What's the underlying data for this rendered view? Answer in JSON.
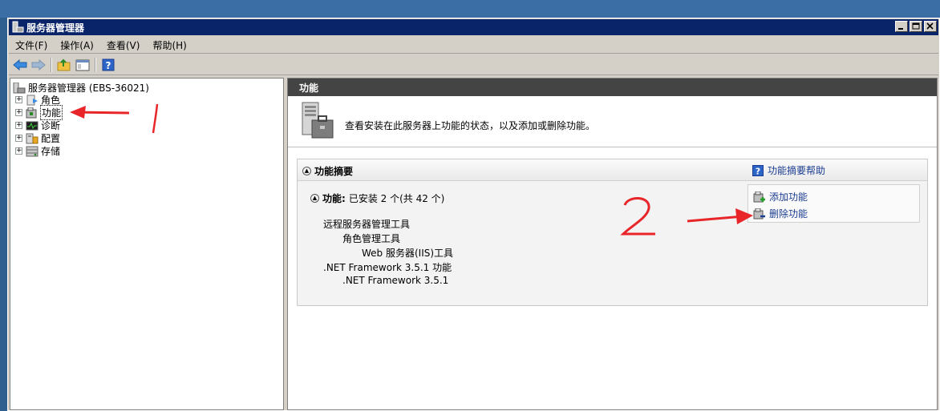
{
  "window": {
    "title": "服务器管理器"
  },
  "menu": {
    "items": [
      "文件(F)",
      "操作(A)",
      "查看(V)",
      "帮助(H)"
    ]
  },
  "toolbar": {
    "icons": [
      "back-icon",
      "forward-icon",
      "up-folder-icon",
      "show-hide-tree-icon",
      "help-icon"
    ]
  },
  "tree": {
    "root_label": "服务器管理器 (EBS-36021)",
    "items": [
      {
        "label": "角色",
        "icon": "roles-icon"
      },
      {
        "label": "功能",
        "icon": "features-icon",
        "selected": true
      },
      {
        "label": "诊断",
        "icon": "diagnostics-icon"
      },
      {
        "label": "配置",
        "icon": "configuration-icon"
      },
      {
        "label": "存储",
        "icon": "storage-icon"
      }
    ]
  },
  "right_pane": {
    "header": "功能",
    "intro_text": "查看安装在此服务器上功能的状态，以及添加或删除功能。",
    "summary": {
      "title": "功能摘要",
      "help_link": "功能摘要帮助",
      "features_label": "功能:",
      "features_status": "已安装 2 个(共 42 个)",
      "actions": {
        "add": "添加功能",
        "remove": "删除功能"
      },
      "installed": [
        {
          "label": "远程服务器管理工具",
          "level": 0
        },
        {
          "label": "角色管理工具",
          "level": 1
        },
        {
          "label": "Web 服务器(IIS)工具",
          "level": 2
        },
        {
          "label": ".NET Framework 3.5.1 功能",
          "level": 0
        },
        {
          "label": ".NET Framework 3.5.1",
          "level": 1
        }
      ]
    }
  },
  "colors": {
    "title_bar": "#0a246a",
    "content_header": "#444444",
    "link": "#1a3d91",
    "annotation": "#e8262a"
  }
}
